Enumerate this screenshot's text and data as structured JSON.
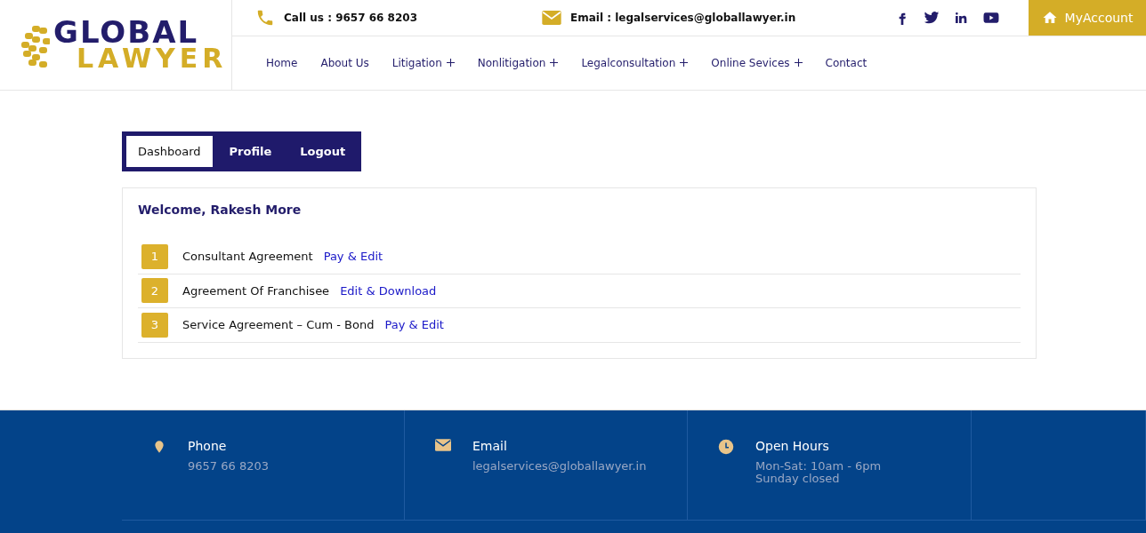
{
  "logo": {
    "top": "GLOBAL",
    "bottom": "LAWYER"
  },
  "topbar": {
    "phone": "Call us : 9657 66 8203",
    "email": "Email : legalservices@globallawyer.in",
    "account_button": "MyAccount"
  },
  "nav": [
    {
      "label": "Home",
      "has_submenu": false
    },
    {
      "label": "About Us",
      "has_submenu": false
    },
    {
      "label": "Litigation",
      "has_submenu": true
    },
    {
      "label": "Nonlitigation",
      "has_submenu": true
    },
    {
      "label": "Legalconsultation",
      "has_submenu": true
    },
    {
      "label": "Online Sevices",
      "has_submenu": true
    },
    {
      "label": "Contact",
      "has_submenu": false
    }
  ],
  "tabs": [
    {
      "label": "Dashboard",
      "selected": true
    },
    {
      "label": "Profile",
      "selected": false
    },
    {
      "label": "Logout",
      "selected": false
    }
  ],
  "panel": {
    "welcome": "Welcome, Rakesh More",
    "items": [
      {
        "number": "1",
        "title": "Consultant Agreement",
        "action": "Pay & Edit"
      },
      {
        "number": "2",
        "title": "Agreement Of Franchisee",
        "action": "Edit & Download"
      },
      {
        "number": "3",
        "title": "Service Agreement – Cum - Bond",
        "action": "Pay & Edit"
      }
    ]
  },
  "footer": [
    {
      "kind": "phone",
      "title": "Phone",
      "lines": [
        "9657 66 8203"
      ]
    },
    {
      "kind": "email",
      "title": "Email",
      "lines": [
        "legalservices@globallawyer.in"
      ]
    },
    {
      "kind": "hours",
      "title": "Open Hours",
      "lines": [
        "Mon-Sat: 10am - 6pm",
        "Sunday closed"
      ]
    }
  ]
}
